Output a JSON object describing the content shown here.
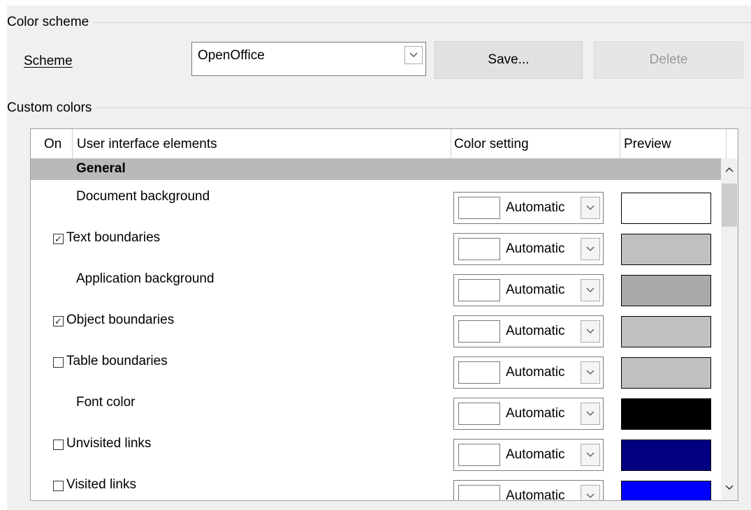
{
  "color_scheme": {
    "group_title": "Color scheme",
    "scheme_label": "Scheme",
    "scheme_value": "OpenOffice",
    "save_label": "Save...",
    "delete_label": "Delete"
  },
  "custom_colors": {
    "group_title": "Custom colors",
    "columns": {
      "on": "On",
      "elements": "User interface elements",
      "setting": "Color setting",
      "preview": "Preview"
    },
    "section": "General",
    "rows": [
      {
        "label": "Document background",
        "has_checkbox": false,
        "checked": false,
        "setting": "Automatic",
        "preview_color": "#ffffff"
      },
      {
        "label": "Text boundaries",
        "has_checkbox": true,
        "checked": true,
        "setting": "Automatic",
        "preview_color": "#c0c0c0"
      },
      {
        "label": "Application background",
        "has_checkbox": false,
        "checked": false,
        "setting": "Automatic",
        "preview_color": "#a9a9a9"
      },
      {
        "label": "Object boundaries",
        "has_checkbox": true,
        "checked": true,
        "setting": "Automatic",
        "preview_color": "#c0c0c0"
      },
      {
        "label": "Table boundaries",
        "has_checkbox": true,
        "checked": false,
        "setting": "Automatic",
        "preview_color": "#c0c0c0"
      },
      {
        "label": "Font color",
        "has_checkbox": false,
        "checked": false,
        "setting": "Automatic",
        "preview_color": "#000000"
      },
      {
        "label": "Unvisited links",
        "has_checkbox": true,
        "checked": false,
        "setting": "Automatic",
        "preview_color": "#000080"
      },
      {
        "label": "Visited links",
        "has_checkbox": true,
        "checked": false,
        "setting": "Automatic",
        "preview_color": "#0000ff"
      }
    ]
  },
  "colors": {
    "section_bg": "#b9b9b9",
    "panel_bg": "#f0f0f0",
    "button_bg": "#e1e1e1"
  }
}
